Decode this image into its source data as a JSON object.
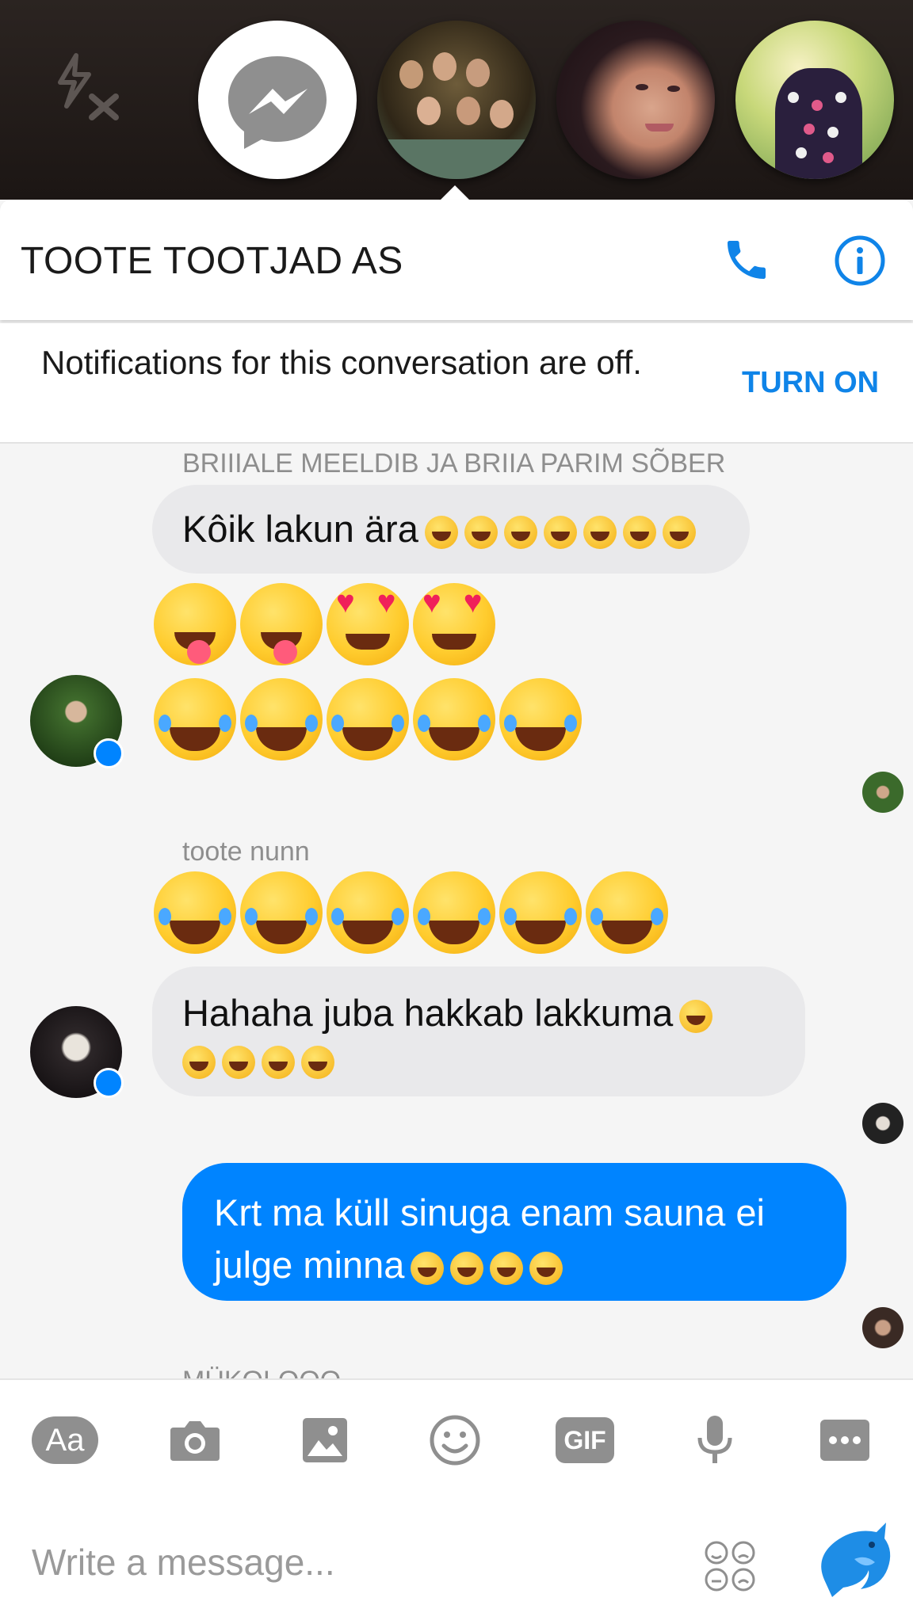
{
  "chat_heads": {
    "icons": [
      "flash-off-icon",
      "messenger-icon"
    ],
    "avatars": [
      "group-photo-avatar",
      "girl-avatar",
      "flowers-avatar"
    ]
  },
  "header": {
    "title": "TOOTE TOOTJAD AS",
    "icons": [
      "phone-icon",
      "info-icon"
    ],
    "accent": "#0f84e8"
  },
  "notification": {
    "text": "Notifications for this conversation are off.",
    "action": "TURN ON"
  },
  "messages": [
    {
      "sender": "BRIIIALE MEELDIB JA BRIIA PARIM SÕBER",
      "text": "Kôik lakun ära",
      "emoji_count": 7
    },
    {
      "sender": "toote nunn",
      "text": "Hahaha juba hakkab lakkuma",
      "emoji_count": 5
    },
    {
      "sender": "",
      "text": "Krt ma küll sinuga enam sauna ei julge minna",
      "emoji_count": 4,
      "own": true
    }
  ],
  "next_sender_partial": "MÜKOLOOO",
  "composer": {
    "tools": [
      "text-size-icon",
      "camera-icon",
      "gallery-icon",
      "emoji-icon",
      "gif-icon",
      "microphone-icon",
      "more-icon"
    ],
    "aa_label": "Aa",
    "gif_label": "GIF",
    "placeholder": "Write a message...",
    "send_icon": "dolphin-icon"
  },
  "colors": {
    "own_bubble": "#0084ff",
    "other_bubble": "#e9e9eb"
  }
}
